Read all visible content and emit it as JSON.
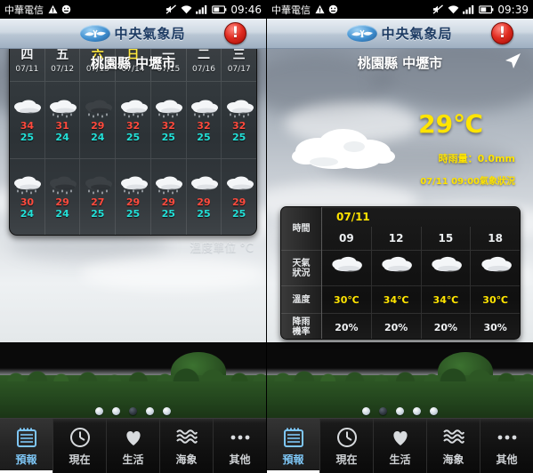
{
  "screens": [
    {
      "id": "forecast-week",
      "statusbar": {
        "carrier": "中華電信",
        "time": "09:46",
        "icons": [
          "warning-icon",
          "smiley-icon",
          "mute-icon",
          "wifi-icon",
          "signal-icon",
          "battery-icon"
        ]
      },
      "appbar": {
        "title": "中央氣象局",
        "alert_label": "!"
      },
      "location": "桃園縣 中壢市",
      "unit_note": "溫度單位 °C",
      "week": {
        "days": [
          {
            "dow": "四",
            "date": "07/11",
            "weekend": false
          },
          {
            "dow": "五",
            "date": "07/12",
            "weekend": false
          },
          {
            "dow": "六",
            "date": "07/13",
            "weekend": true
          },
          {
            "dow": "日",
            "date": "07/14",
            "weekend": true
          },
          {
            "dow": "一",
            "date": "07/15",
            "weekend": false
          },
          {
            "dow": "二",
            "date": "07/16",
            "weekend": false
          },
          {
            "dow": "三",
            "date": "07/17",
            "weekend": false
          }
        ],
        "rows": [
          {
            "period": "day",
            "icons": [
              "cloudy",
              "rain",
              "thunderstorm",
              "rain",
              "rain",
              "rain",
              "rain"
            ],
            "high": [
              "34",
              "31",
              "29",
              "32",
              "32",
              "32",
              "32"
            ],
            "low": [
              "25",
              "24",
              "24",
              "25",
              "25",
              "25",
              "25"
            ]
          },
          {
            "period": "night",
            "icons": [
              "rain",
              "thunderstorm",
              "thunderstorm",
              "rain",
              "rain",
              "cloudy",
              "cloudy"
            ],
            "high": [
              "30",
              "29",
              "27",
              "29",
              "29",
              "29",
              "29"
            ],
            "low": [
              "24",
              "24",
              "25",
              "25",
              "25",
              "25",
              "25"
            ]
          }
        ]
      },
      "dots": {
        "count": 5,
        "active_index": 2
      }
    },
    {
      "id": "forecast-now",
      "statusbar": {
        "carrier": "中華電信",
        "time": "09:39",
        "icons": [
          "warning-icon",
          "smiley-icon",
          "mute-icon",
          "wifi-icon",
          "signal-icon",
          "battery-icon"
        ]
      },
      "appbar": {
        "title": "中央氣象局",
        "alert_label": "!"
      },
      "location": "桃園縣 中壢市",
      "current": {
        "temperature": "29℃",
        "rainfall": "時雨量：0.0mm",
        "observed": "07/11 09:00氣象狀況",
        "icon": "cloudy"
      },
      "hourly": {
        "date": "07/11",
        "labels": {
          "time": "時間",
          "condition": "天氣\n狀況",
          "temperature": "溫度",
          "rain": "降雨\n機率"
        },
        "label_time": "時間",
        "label_cond_1": "天氣",
        "label_cond_2": "狀況",
        "label_temp": "溫度",
        "label_rain_1": "降雨",
        "label_rain_2": "機率",
        "times": [
          "09",
          "12",
          "15",
          "18"
        ],
        "conditions": [
          "cloudy",
          "cloudy",
          "cloudy",
          "cloudy"
        ],
        "temperatures": [
          "30℃",
          "34℃",
          "34℃",
          "30℃"
        ],
        "rain_chance": [
          "20%",
          "20%",
          "20%",
          "30%"
        ]
      },
      "dots": {
        "count": 5,
        "active_index": 1
      }
    }
  ],
  "tabbar": {
    "items": [
      {
        "label": "預報",
        "icon": "calendar-icon",
        "active": true
      },
      {
        "label": "現在",
        "icon": "clock-icon",
        "active": false
      },
      {
        "label": "生活",
        "icon": "heart-icon",
        "active": false
      },
      {
        "label": "海象",
        "icon": "waves-icon",
        "active": false
      },
      {
        "label": "其他",
        "icon": "more-dots-icon",
        "active": false
      }
    ]
  },
  "colors": {
    "high_temp": "#ff4a3d",
    "low_temp": "#23e0d8",
    "accent_yellow": "#ffe400",
    "tab_active": "#7ec6f5"
  }
}
